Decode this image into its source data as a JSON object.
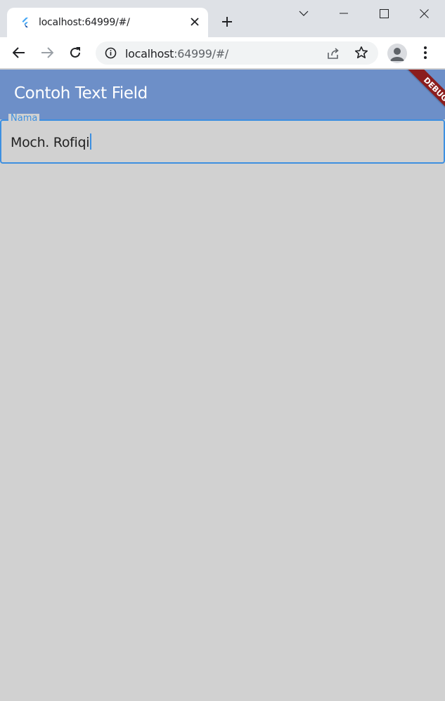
{
  "browser": {
    "tab": {
      "title": "localhost:64999/#/"
    },
    "address_bar": {
      "host": "localhost",
      "rest": ":64999/#/"
    }
  },
  "app": {
    "appbar": {
      "title": "Contoh Text Field",
      "debug_banner": "DEBUG"
    },
    "text_field": {
      "label": "Nama",
      "value": "Moch. Rofiqi"
    }
  },
  "colors": {
    "appbar": "#6d8fc8",
    "field_accent": "#3d8fe0",
    "background": "#d1d1d1",
    "debug_banner": "#8b1d1d"
  },
  "icons": [
    "flutter-favicon-icon",
    "close-tab-icon",
    "new-tab-icon",
    "tab-search-icon",
    "minimize-icon",
    "maximize-icon",
    "close-window-icon",
    "back-icon",
    "forward-icon",
    "reload-icon",
    "info-icon",
    "share-icon",
    "bookmark-star-icon",
    "profile-icon",
    "more-menu-icon"
  ]
}
